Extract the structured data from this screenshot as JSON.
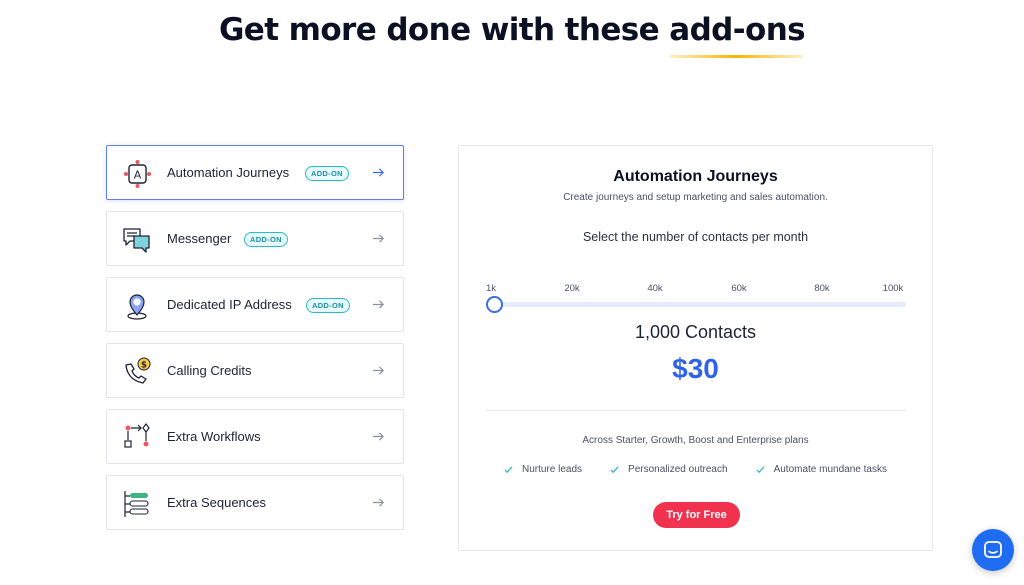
{
  "hero": {
    "title_prefix": "Get more done with these",
    "title_highlight": "add-ons"
  },
  "addons": [
    {
      "label": "Automation Journeys",
      "badge": "ADD-ON",
      "icon": "automation-icon",
      "active": true
    },
    {
      "label": "Messenger",
      "badge": "ADD-ON",
      "icon": "messenger-icon",
      "active": false
    },
    {
      "label": "Dedicated IP Address",
      "badge": "ADD-ON",
      "icon": "ip-location-icon",
      "active": false
    },
    {
      "label": "Calling Credits",
      "badge": "",
      "icon": "phone-dollar-icon",
      "active": false
    },
    {
      "label": "Extra Workflows",
      "badge": "",
      "icon": "workflow-icon",
      "active": false
    },
    {
      "label": "Extra Sequences",
      "badge": "",
      "icon": "sequence-icon",
      "active": false
    }
  ],
  "panel": {
    "title": "Automation Journeys",
    "description": "Create journeys and setup marketing and sales automation.",
    "prompt": "Select the number of contacts per month",
    "slider": {
      "ticks": [
        "1k",
        "20k",
        "40k",
        "60k",
        "80k",
        "100k"
      ],
      "value_fraction": 0
    },
    "contacts": "1,000 Contacts",
    "price": "$30",
    "plans_note": "Across Starter, Growth, Boost and Enterprise plans",
    "features": [
      "Nurture leads",
      "Personalized outreach",
      "Automate mundane tasks"
    ],
    "cta_label": "Try for Free"
  },
  "colors": {
    "accent_blue": "#2f63e8",
    "cta_red": "#f0324e",
    "badge_teal": "#2bb8c9",
    "highlight_yellow": "#f7b500",
    "chat_blue": "#1f6bf2"
  },
  "chat": {
    "icon": "chat-icon"
  }
}
